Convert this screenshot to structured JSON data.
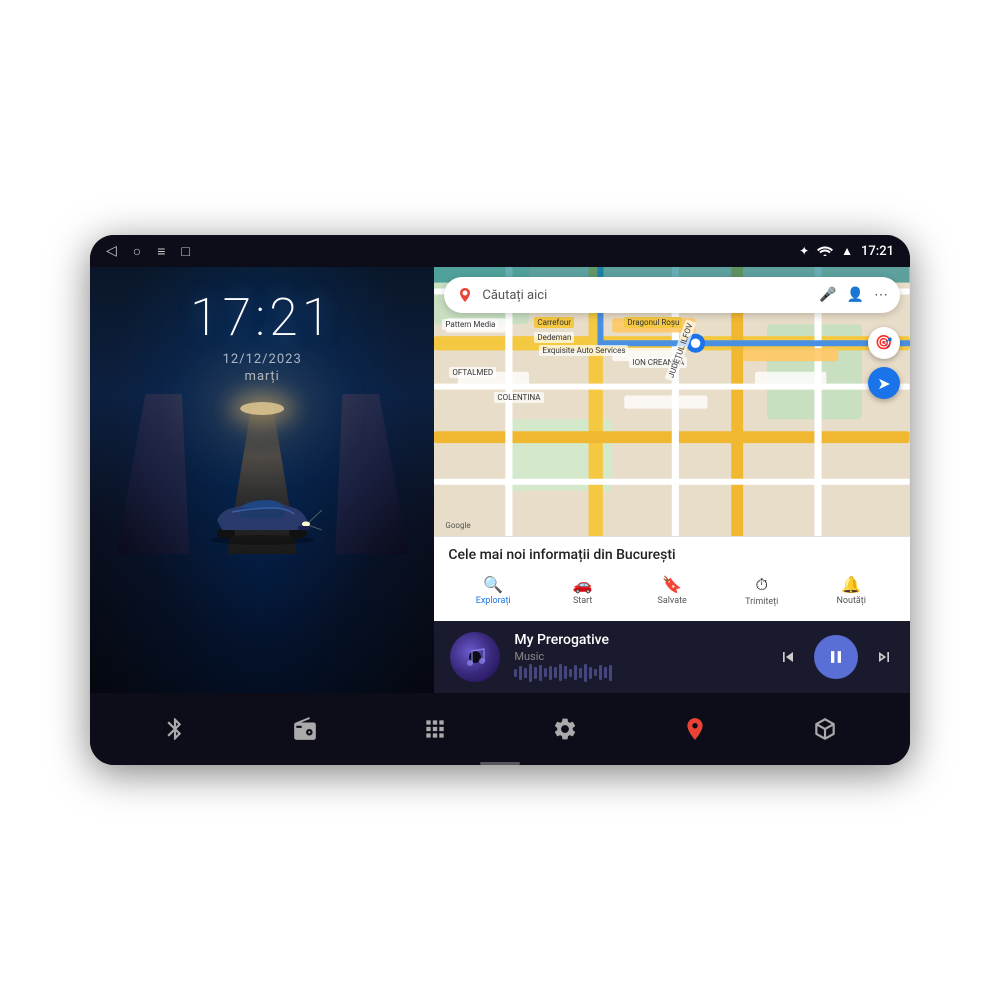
{
  "device": {
    "status_bar": {
      "back_icon": "◁",
      "home_icon": "○",
      "menu_icon": "≡",
      "screenshot_icon": "□",
      "bluetooth_icon": "✦",
      "wifi_icon": "WiFi",
      "signal_icon": "▲",
      "time": "17:21"
    },
    "left_panel": {
      "time": "17:21",
      "date": "12/12/2023",
      "day": "marți"
    },
    "right_panel": {
      "map": {
        "search_placeholder": "Căutați aici",
        "info_text": "Cele mai noi informații din București",
        "nav_tabs": [
          {
            "label": "Explorați",
            "icon": "🔍",
            "active": true
          },
          {
            "label": "Start",
            "icon": "🚗"
          },
          {
            "label": "Salvate",
            "icon": "🔖"
          },
          {
            "label": "Trimiteți",
            "icon": "⏱"
          },
          {
            "label": "Noutăți",
            "icon": "🔔"
          }
        ]
      },
      "music": {
        "title": "My Prerogative",
        "subtitle": "Music"
      }
    },
    "bottom_dock": {
      "items": [
        {
          "icon": "bluetooth",
          "label": "Bluetooth"
        },
        {
          "icon": "radio",
          "label": "Radio"
        },
        {
          "icon": "apps",
          "label": "Apps"
        },
        {
          "icon": "settings",
          "label": "Settings"
        },
        {
          "icon": "maps",
          "label": "Maps"
        },
        {
          "icon": "box",
          "label": "3D"
        }
      ]
    }
  }
}
